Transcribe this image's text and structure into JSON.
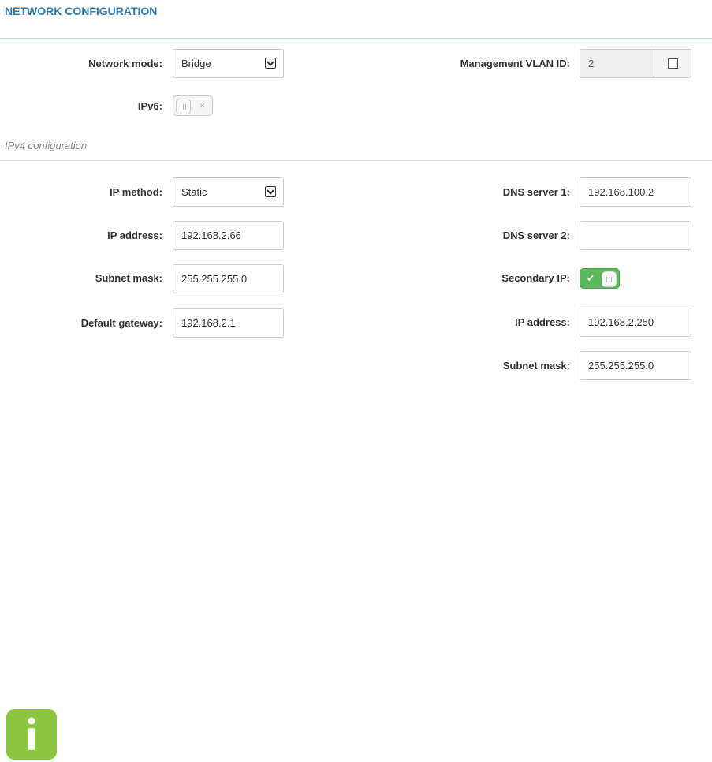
{
  "header": {
    "title": "NETWORK CONFIGURATION"
  },
  "network": {
    "mode_label": "Network mode:",
    "mode_value": "Bridge",
    "vlan_label": "Management VLAN ID:",
    "vlan_value": "2",
    "vlan_checkbox_checked": false,
    "ipv6_label": "IPv6:",
    "ipv6_enabled": false,
    "ipv6_toggle_mark": "×"
  },
  "ipv4": {
    "section_title": "IPv4 configuration",
    "method_label": "IP method:",
    "method_value": "Static",
    "ip_label": "IP address:",
    "ip_value": "192.168.2.66",
    "mask_label": "Subnet mask:",
    "mask_value": "255.255.255.0",
    "gateway_label": "Default gateway:",
    "gateway_value": "192.168.2.1",
    "dns1_label": "DNS server 1:",
    "dns1_value": "192.168.100.2",
    "dns2_label": "DNS server 2:",
    "dns2_value": "",
    "secondary_label": "Secondary IP:",
    "secondary_enabled": true,
    "secondary_toggle_mark": "✔",
    "secondary_ip_label": "IP address:",
    "secondary_ip_value": "192.168.2.250",
    "secondary_mask_label": "Subnet mask:",
    "secondary_mask_value": "255.255.255.0"
  },
  "icons": {
    "info": "info-icon",
    "dropdown": "chevron-down-icon"
  },
  "colors": {
    "title": "#2a78b5",
    "toggle_on": "#5cb85c",
    "info_icon": "#8cc63f"
  }
}
